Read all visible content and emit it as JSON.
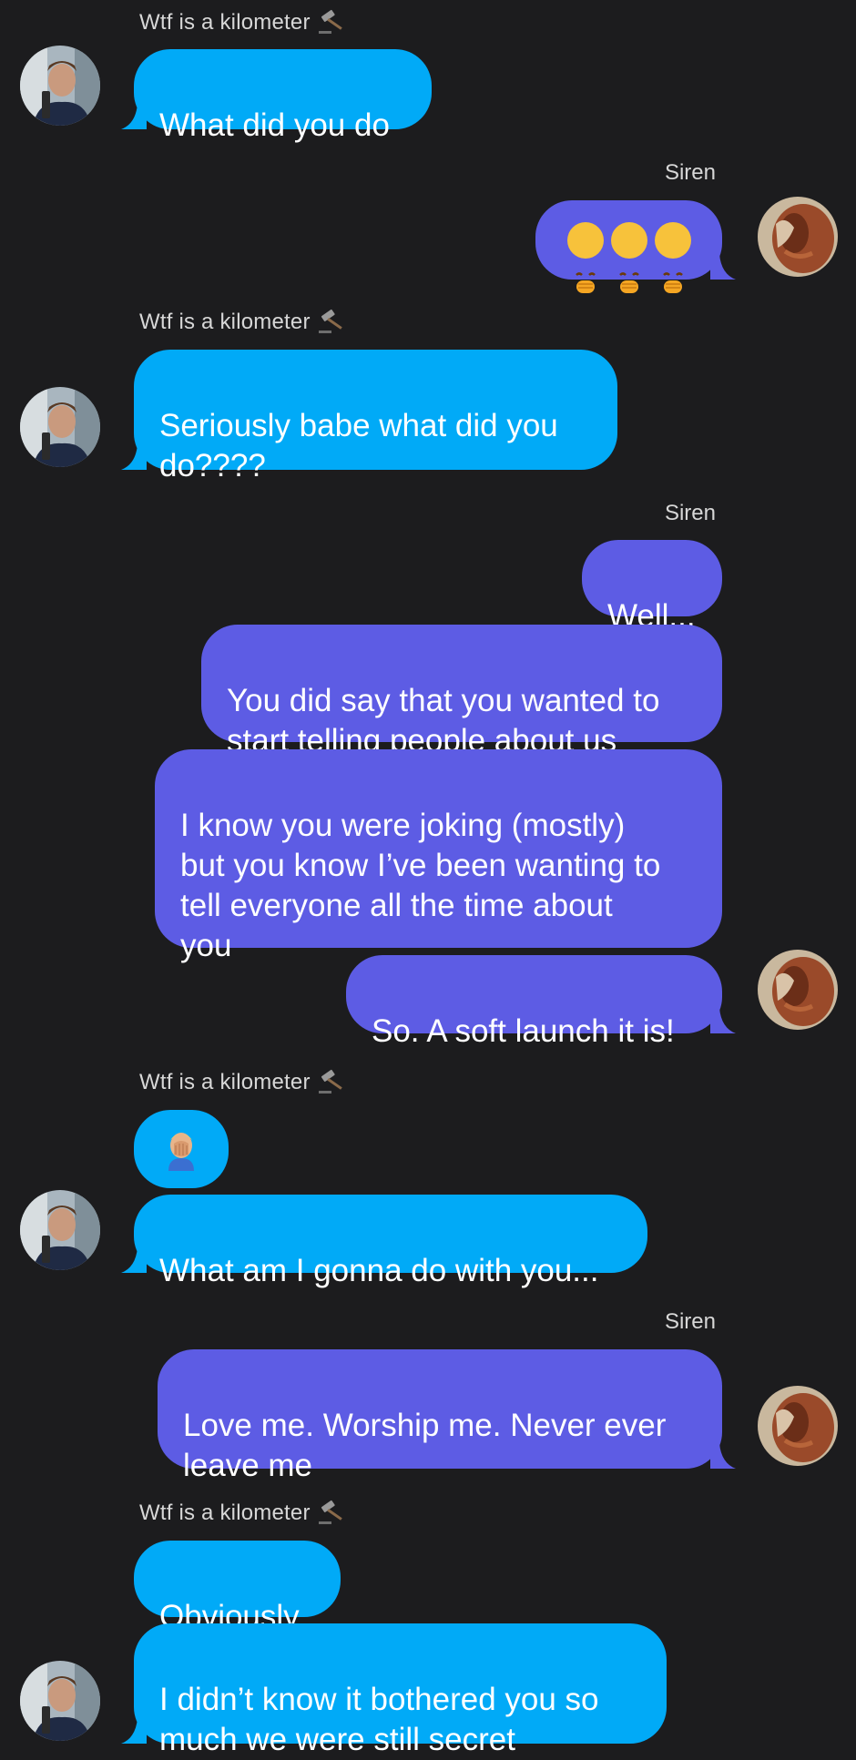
{
  "participants": {
    "other_name": "Wtf is a kilometer",
    "self_name": "Siren"
  },
  "icons": {
    "name_icon": "gavel-icon",
    "emoji_hand_over_mouth": "face-with-hand-over-mouth-emoji",
    "emoji_facepalm": "man-facepalming-emoji"
  },
  "colors": {
    "background": "#1c1c1e",
    "incoming_bubble": "#01aaf7",
    "outgoing_bubble": "#5d5ce4",
    "name_text": "#d7d7d7"
  },
  "messages": {
    "m1": "What did you do",
    "m2_emojis": "🤭🤭🤭",
    "m3": "Seriously babe what did you\ndo????",
    "m4": "Well...",
    "m5": "You did say that you wanted to\nstart telling people about us",
    "m6": "I know you were joking (mostly)\nbut you know I’ve been wanting to\ntell everyone all the time about\nyou",
    "m7": "So. A soft launch it is!",
    "m8_emoji": "🤦‍♂️",
    "m9": "What am I gonna do with you...",
    "m10": "Love me. Worship me. Never ever\nleave me",
    "m11": "Obviously",
    "m12": "I didn’t know it bothered you so\nmuch we were still secret"
  }
}
